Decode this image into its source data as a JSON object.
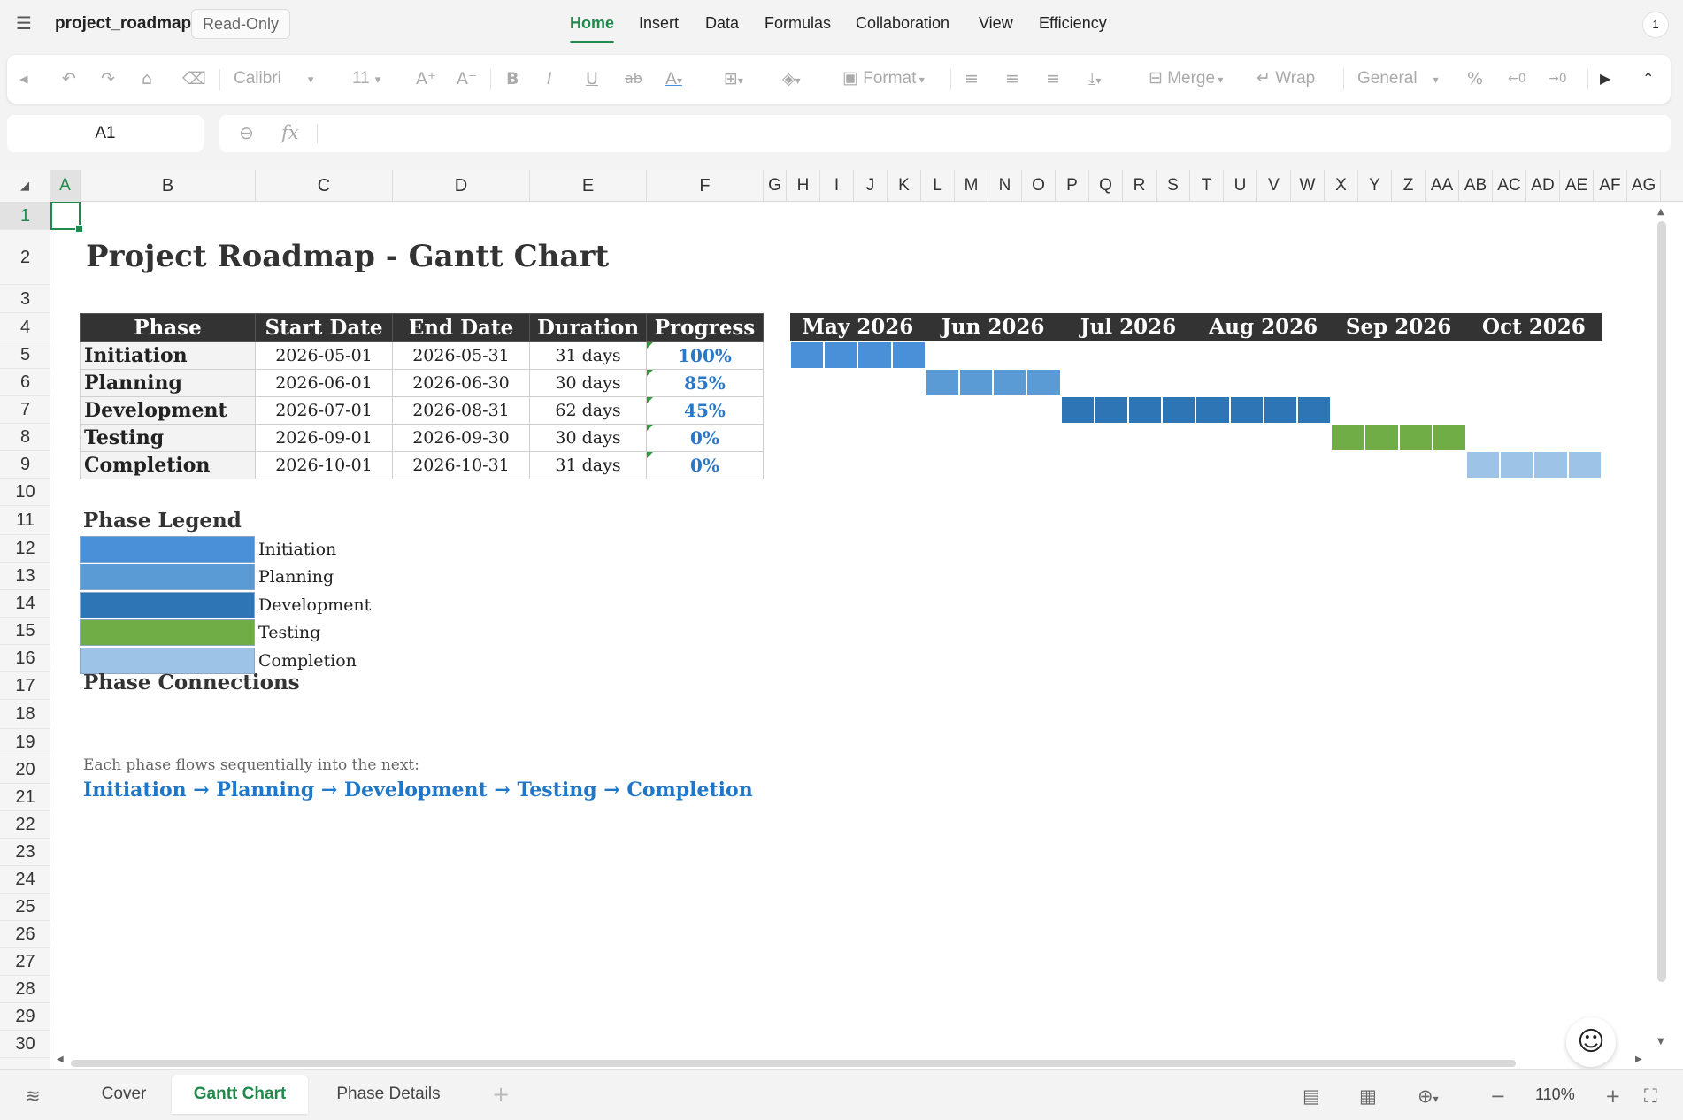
{
  "app": {
    "doc_name": "project_roadmap",
    "mode_badge": "Read-Only",
    "menu": [
      "Home",
      "Insert",
      "Data",
      "Formulas",
      "Collaboration",
      "View",
      "Efficiency"
    ],
    "active_menu": "Home",
    "notification_count": "1"
  },
  "toolbar": {
    "font": "Calibri",
    "font_size": "11",
    "format_label": "Format",
    "merge_label": "Merge",
    "wrap_label": "Wrap",
    "number_format": "General"
  },
  "formula_bar": {
    "cell_ref": "A1",
    "fx": "fx",
    "value": ""
  },
  "columns": [
    "A",
    "B",
    "C",
    "D",
    "E",
    "F",
    "G",
    "H",
    "I",
    "J",
    "K",
    "L",
    "M",
    "N",
    "O",
    "P",
    "Q",
    "R",
    "S",
    "T",
    "U",
    "V",
    "W",
    "X",
    "Y",
    "Z",
    "AA",
    "AB",
    "AC",
    "AD",
    "AE",
    "AF",
    "AG"
  ],
  "rows": [
    "1",
    "2",
    "3",
    "4",
    "5",
    "6",
    "7",
    "8",
    "9",
    "10",
    "11",
    "12",
    "13",
    "14",
    "15",
    "16",
    "17",
    "18",
    "19",
    "20",
    "21",
    "22",
    "23",
    "24",
    "25",
    "26",
    "27",
    "28",
    "29",
    "30"
  ],
  "sheet": {
    "title": "Project Roadmap - Gantt Chart",
    "table_headers": [
      "Phase",
      "Start Date",
      "End Date",
      "Duration",
      "Progress"
    ],
    "phases": [
      {
        "phase": "Initiation",
        "start": "2026-05-01",
        "end": "2026-05-31",
        "duration": "31 days",
        "progress": "100%",
        "color": "#4a90d9"
      },
      {
        "phase": "Planning",
        "start": "2026-06-01",
        "end": "2026-06-30",
        "duration": "30 days",
        "progress": "85%",
        "color": "#5b9bd5"
      },
      {
        "phase": "Development",
        "start": "2026-07-01",
        "end": "2026-08-31",
        "duration": "62 days",
        "progress": "45%",
        "color": "#2e75b6"
      },
      {
        "phase": "Testing",
        "start": "2026-09-01",
        "end": "2026-09-30",
        "duration": "30 days",
        "progress": "0%",
        "color": "#70ad47"
      },
      {
        "phase": "Completion",
        "start": "2026-10-01",
        "end": "2026-10-31",
        "duration": "31 days",
        "progress": "0%",
        "color": "#9dc3e6"
      }
    ],
    "months": [
      "May 2026",
      "Jun 2026",
      "Jul 2026",
      "Aug 2026",
      "Sep 2026",
      "Oct 2026"
    ],
    "legend_title": "Phase Legend",
    "legend": [
      "Initiation",
      "Planning",
      "Development",
      "Testing",
      "Completion"
    ],
    "connections_title": "Phase Connections",
    "connections_note": "Each phase flows sequentially into the next:",
    "connections_flow": "Initiation → Planning → Development → Testing → Completion"
  },
  "chart_data": {
    "type": "bar",
    "title": "Project Roadmap - Gantt Chart",
    "categories": [
      "Initiation",
      "Planning",
      "Development",
      "Testing",
      "Completion"
    ],
    "series": [
      {
        "name": "Start Date",
        "values": [
          "2026-05-01",
          "2026-06-01",
          "2026-07-01",
          "2026-09-01",
          "2026-10-01"
        ]
      },
      {
        "name": "End Date",
        "values": [
          "2026-05-31",
          "2026-06-30",
          "2026-08-31",
          "2026-09-30",
          "2026-10-31"
        ]
      }
    ],
    "x_ticks": [
      "May 2026",
      "Jun 2026",
      "Jul 2026",
      "Aug 2026",
      "Sep 2026",
      "Oct 2026"
    ],
    "week_cells": [
      4,
      4,
      8,
      4,
      4
    ]
  },
  "sheet_tabs": [
    "Cover",
    "Gantt Chart",
    "Phase Details"
  ],
  "active_tab": "Gantt Chart",
  "zoom": "110%"
}
